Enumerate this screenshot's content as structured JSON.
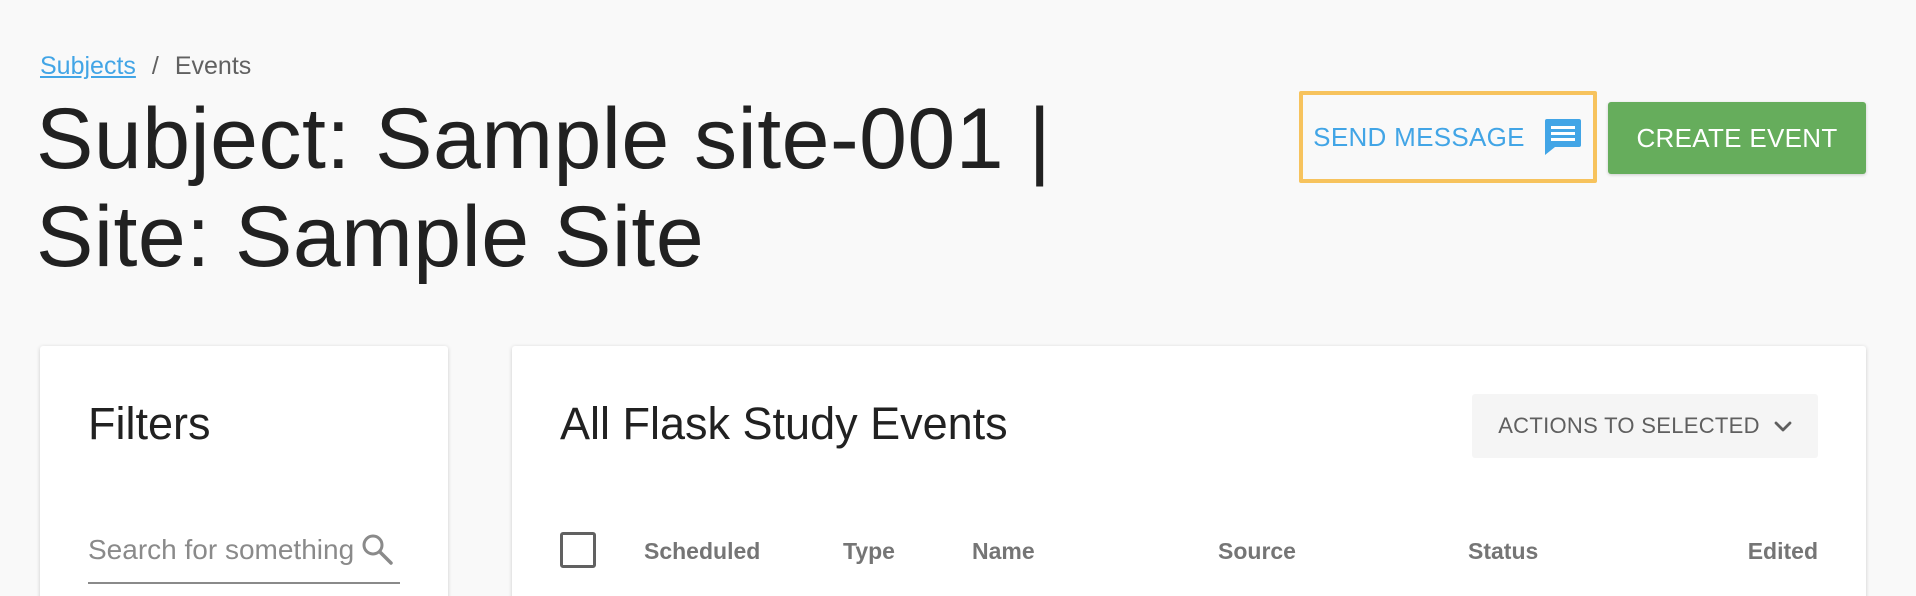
{
  "breadcrumb": {
    "items": [
      {
        "label": "Subjects",
        "link": true
      },
      {
        "label": "Events",
        "link": false
      }
    ],
    "separator": "/"
  },
  "page": {
    "title": "Subject: Sample site-001 | Site: Sample Site"
  },
  "header_actions": {
    "send_message_label": "SEND MESSAGE",
    "send_message_icon": "message-icon",
    "create_event_label": "CREATE EVENT"
  },
  "filters": {
    "title": "Filters",
    "search_placeholder": "Search for something",
    "search_value": "",
    "search_icon": "search-icon"
  },
  "events": {
    "title": "All Flask Study Events",
    "actions_label": "ACTIONS TO SELECTED",
    "actions_icon": "chevron-down-icon",
    "columns": [
      "Scheduled",
      "Type",
      "Name",
      "Source",
      "Status",
      "Edited"
    ]
  },
  "colors": {
    "link": "#42a5e6",
    "accent_blue": "#42a5e6",
    "create_green": "#66ad5c",
    "focus_outline": "#f7c35d",
    "background": "#f9f9f9"
  }
}
